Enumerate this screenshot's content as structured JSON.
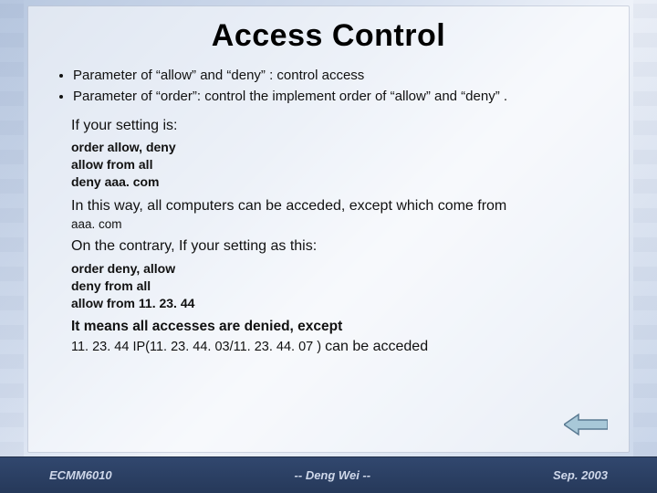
{
  "title": "Access Control",
  "bullets": [
    "Parameter of “allow” and “deny” : control access",
    "Parameter of “order”: control the implement order of “allow” and “deny” ."
  ],
  "intro1": "If your setting is:",
  "config1": "order allow, deny\nallow from all\ndeny aaa. com",
  "result1_lead": "In this way, all computers can be acceded, except  which come from",
  "result1_host": "aaa. com",
  "intro2": "On the contrary, If your setting as this:",
  "config2": "order deny, allow\ndeny from all\nallow from 11. 23. 44",
  "result2_lead": "It means all  accesses are denied, except",
  "result2_detail_prefix": "11. 23. 44 IP(11. 23. 44. 03/11. 23. 44. 07 ) ",
  "result2_detail_suffix": "can be acceded",
  "footer": {
    "left": "ECMM6010",
    "center": "-- Deng Wei --",
    "right": "Sep. 2003"
  },
  "colors": {
    "arrow_fill": "#a8c8d8",
    "arrow_stroke": "#5a7a92"
  }
}
